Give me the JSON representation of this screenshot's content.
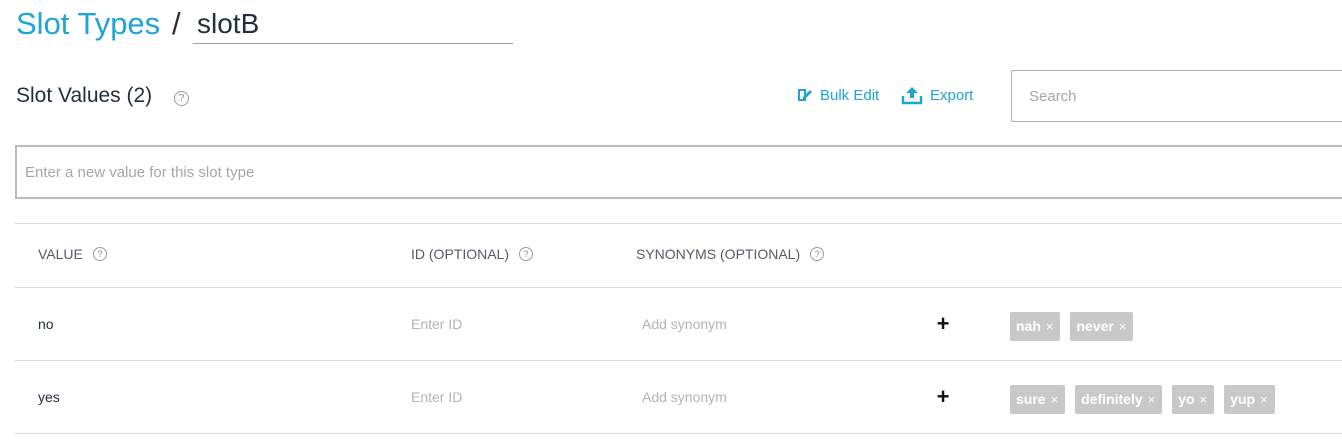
{
  "breadcrumb": {
    "parent_label": "Slot Types",
    "separator": "/",
    "current_name": "slotB"
  },
  "section": {
    "title": "Slot Values (2)",
    "help_glyph": "?"
  },
  "toolbar": {
    "bulk_edit_label": "Bulk Edit",
    "bulk_edit_icon": "bulk-edit-icon",
    "export_label": "Export",
    "export_icon": "upload-icon",
    "search_placeholder": "Search"
  },
  "new_value": {
    "placeholder": "Enter a new value for this slot type"
  },
  "table": {
    "columns": [
      {
        "label": "VALUE"
      },
      {
        "label": "ID (OPTIONAL)"
      },
      {
        "label": "SYNONYMS (OPTIONAL)"
      }
    ],
    "id_placeholder": "Enter ID",
    "synonym_placeholder": "Add synonym",
    "add_glyph": "+",
    "remove_glyph": "×",
    "rows": [
      {
        "value": "no",
        "synonyms": [
          "nah",
          "never"
        ]
      },
      {
        "value": "yes",
        "synonyms": [
          "sure",
          "definitely",
          "yo",
          "yup"
        ]
      }
    ]
  },
  "colors": {
    "accent": "#1fa4d6",
    "chip_bg": "#c8c8c8",
    "text": "#232f3e"
  }
}
